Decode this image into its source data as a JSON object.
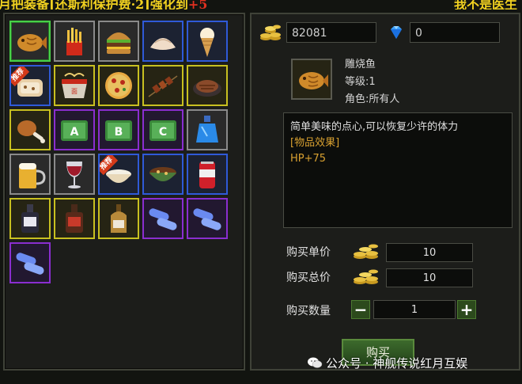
{
  "banner": {
    "left": "月把装备[还斯利保护费·2]强化到",
    "left_red": "+5",
    "right": "我不是医生"
  },
  "currency": {
    "gold": "82081",
    "diamonds": "0"
  },
  "selected_item": {
    "name": "雕烧鱼",
    "level": "等级:1",
    "role": "角色:所有人",
    "description": "简单美味的点心,可以恢复少许的体力",
    "effect_header": "[物品效果]",
    "effect": "HP+75"
  },
  "purchase": {
    "unit_price_label": "购买单价",
    "unit_price": "10",
    "total_price_label": "购买总价",
    "total_price": "10",
    "quantity_label": "购买数量",
    "quantity": "1",
    "minus": "−",
    "plus": "+",
    "buy_label": "购买"
  },
  "tag_text": "推荐",
  "slots": [
    {
      "name": "taiyaki",
      "border": "gray",
      "selected": true
    },
    {
      "name": "fries",
      "border": "gray"
    },
    {
      "name": "burger",
      "border": "gray"
    },
    {
      "name": "dumpling",
      "border": "blue"
    },
    {
      "name": "ice-cream",
      "border": "blue"
    },
    {
      "name": "bread",
      "border": "blue",
      "tag": true
    },
    {
      "name": "noodle-bowl",
      "border": "yellow"
    },
    {
      "name": "pizza",
      "border": "yellow"
    },
    {
      "name": "skewers",
      "border": "yellow"
    },
    {
      "name": "steak",
      "border": "yellow"
    },
    {
      "name": "drumstick",
      "border": "yellow"
    },
    {
      "name": "ticket-a",
      "border": "purple"
    },
    {
      "name": "ticket-b",
      "border": "purple"
    },
    {
      "name": "ticket-c",
      "border": "purple"
    },
    {
      "name": "blue-potion",
      "border": "gray"
    },
    {
      "name": "beer",
      "border": "gray"
    },
    {
      "name": "wine",
      "border": "gray"
    },
    {
      "name": "rice-bowl",
      "border": "blue",
      "tag": true
    },
    {
      "name": "soup-bowl",
      "border": "blue"
    },
    {
      "name": "soda-can",
      "border": "blue"
    },
    {
      "name": "bottle-1",
      "border": "yellow"
    },
    {
      "name": "bottle-2",
      "border": "yellow"
    },
    {
      "name": "bottle-3",
      "border": "yellow"
    },
    {
      "name": "capsule",
      "border": "purple"
    },
    {
      "name": "capsule",
      "border": "purple"
    },
    {
      "name": "capsule",
      "border": "purple"
    }
  ],
  "watermark": "公众号 · 神舰传说红月互娱"
}
